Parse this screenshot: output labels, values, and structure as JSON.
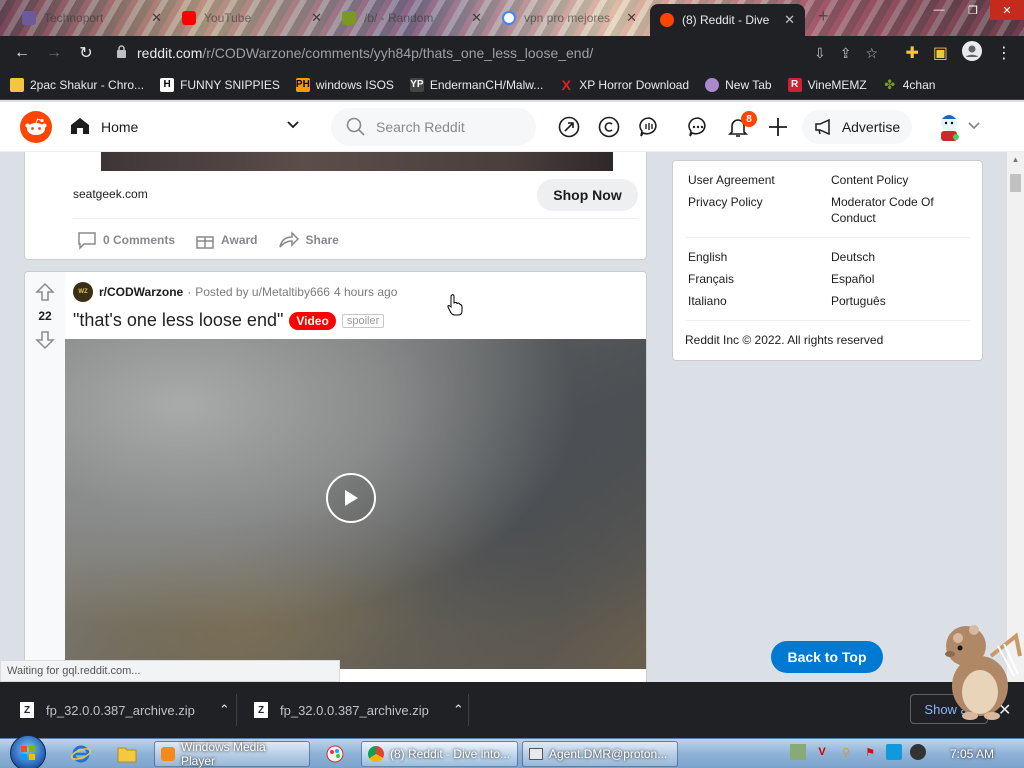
{
  "browser": {
    "tabs": [
      {
        "title": "Technoport",
        "favicon": "sphere-icon",
        "color": "#6b5b9a"
      },
      {
        "title": "YouTube",
        "favicon": "youtube-icon",
        "color": "#ff0000"
      },
      {
        "title": "/b/ - Random",
        "favicon": "clover-icon",
        "color": "#789922"
      },
      {
        "title": "vpn pro mejores",
        "favicon": "google-icon",
        "color": "#4285f4"
      },
      {
        "title": "(8) Reddit - Dive",
        "favicon": "reddit-icon",
        "color": "#ff4500",
        "active": true
      }
    ],
    "url_host": "reddit.com",
    "url_path": "/r/CODWarzone/comments/yyh84p/thats_one_less_loose_end/",
    "bookmarks": [
      {
        "label": "2pac Shakur - Chro...",
        "icon": "bookmark-folder-icon",
        "color": "#f5c542"
      },
      {
        "label": "FUNNY SNIPPIES",
        "icon": "h-icon",
        "color": "#ffffff"
      },
      {
        "label": "windows ISOS",
        "icon": "ph-icon",
        "color": "#ff9900"
      },
      {
        "label": "EndermanCH/Malw...",
        "icon": "yp-icon",
        "color": "#444444"
      },
      {
        "label": "XP Horror Download",
        "icon": "x-icon",
        "color": "#e02020"
      },
      {
        "label": "New Tab",
        "icon": "globe-icon",
        "color": "#aa88cc"
      },
      {
        "label": "VineMEMZ",
        "icon": "r-icon",
        "color": "#cc2233"
      },
      {
        "label": "4chan",
        "icon": "clover-icon",
        "color": "#789922"
      }
    ]
  },
  "reddit": {
    "home_label": "Home",
    "search_placeholder": "Search Reddit",
    "notification_count": "8",
    "advertise_label": "Advertise",
    "accent": "#ff4500",
    "blue": "#0079d3"
  },
  "ad_card": {
    "domain": "seatgeek.com",
    "shop_label": "Shop Now",
    "comments_label": "0 Comments",
    "award_label": "Award",
    "share_label": "Share"
  },
  "post": {
    "votes": "22",
    "subreddit": "r/CODWarzone",
    "posted_by": "Posted by u/Metaltiby666",
    "time": "4 hours ago",
    "title": "\"that's one less loose end\"",
    "flair": "Video",
    "spoiler": "spoiler",
    "subreddit_icon_text": "WZ"
  },
  "sidebar": {
    "links_left": [
      "User Agreement",
      "Privacy Policy"
    ],
    "links_right": [
      "Content Policy",
      "Moderator Code Of Conduct"
    ],
    "languages_left": [
      "English",
      "Français",
      "Italiano"
    ],
    "languages_right": [
      "Deutsch",
      "Español",
      "Português"
    ],
    "copyright": "Reddit Inc © 2022. All rights reserved",
    "back_to_top": "Back to Top"
  },
  "status_text": "Waiting for gql.reddit.com...",
  "downloads": {
    "items": [
      "fp_32.0.0.387_archive.zip",
      "fp_32.0.0.387_archive.zip"
    ],
    "show_all": "Show all"
  },
  "taskbar": {
    "buttons": [
      "Windows Media Player",
      "(8) Reddit - Dive into...",
      "Agent.DMR@proton..."
    ],
    "clock": "7:05 AM"
  }
}
